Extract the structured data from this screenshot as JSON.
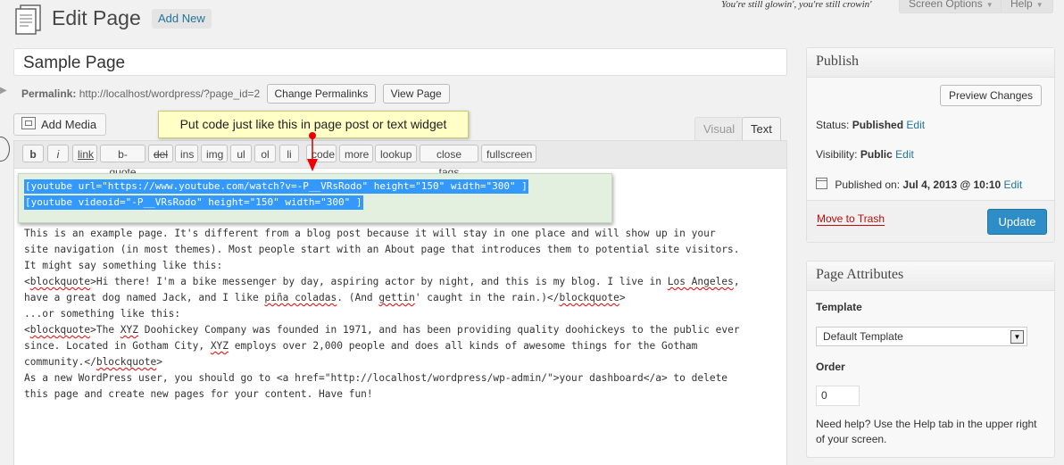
{
  "header": {
    "title": "Edit Page",
    "add_new": "Add New",
    "tagline": "You're still glowin', you're still crowin'",
    "screen_options": "Screen Options",
    "help": "Help"
  },
  "post": {
    "title": "Sample Page",
    "permalink_label": "Permalink:",
    "permalink_url": "http://localhost/wordpress/?page_id=2",
    "change_permalinks": "Change Permalinks",
    "view_page": "View Page"
  },
  "editor": {
    "add_media": "Add Media",
    "tooltip": "Put code just like this in page post or text widget",
    "tabs": {
      "visual": "Visual",
      "text": "Text"
    },
    "quicktags": [
      "b",
      "i",
      "link",
      "b-quote",
      "del",
      "ins",
      "img",
      "ul",
      "ol",
      "li",
      "code",
      "more",
      "lookup",
      "close tags",
      "fullscreen"
    ],
    "shortcode_lines": [
      "[youtube url=\"https://www.youtube.com/watch?v=-P__VRsRodo\" height=\"150\" width=\"300\" ]",
      "[youtube videoid=\"-P__VRsRodo\" height=\"150\" width=\"300\" ]"
    ],
    "content": {
      "p1": "This is an example page. It's different from a blog post because it will stay in one place and will show up in your\nsite navigation (in most themes). Most people start with an About page that introduces them to potential site visitors.\nIt might say something like this:",
      "q1_open": "<",
      "tag_blockquote": "blockquote",
      "q1_a": ">Hi there! I'm a bike messenger by day, aspiring actor by night, and this is my blog. I live in ",
      "q1_la": "Los Angeles",
      "q1_b": ",\nhave a great dog named Jack, and I like ",
      "q1_pina": "piña coladas",
      "q1_c": ". (And ",
      "q1_gettin": "gettin",
      "q1_d": "' caught in the rain.)</",
      "q1_close": ">",
      "p2": "\n...or something like this:\n",
      "q2_a": ">The ",
      "q2_xyz": "XYZ",
      "q2_b": " Doohickey Company was founded in 1971, and has been providing quality doohickeys to the public ever\nsince. Located in Gotham City, ",
      "q2_c": " employs over 2,000 people and does all kinds of awesome things for the Gotham\ncommunity.</",
      "p3": "\nAs a new WordPress user, you should go to <a href=\"http://localhost/wordpress/wp-admin/\">your dashboard</a> to delete\nthis page and create new pages for your content. Have fun!"
    }
  },
  "publish": {
    "heading": "Publish",
    "preview_changes": "Preview Changes",
    "status_label": "Status:",
    "status_value": "Published",
    "visibility_label": "Visibility:",
    "visibility_value": "Public",
    "published_on_label": "Published on:",
    "published_on_value": "Jul 4, 2013 @ 10:10",
    "edit": "Edit",
    "move_to_trash": "Move to Trash",
    "update": "Update"
  },
  "attributes": {
    "heading": "Page Attributes",
    "template_label": "Template",
    "template_value": "Default Template",
    "order_label": "Order",
    "order_value": "0",
    "help_text": "Need help? Use the Help tab in the upper right of your screen."
  },
  "colors": {
    "accent": "#21759b",
    "update_button": "#2e8cc7",
    "tooltip_bg": "#ffffc6",
    "selection": "#3399ff",
    "trash": "#bc0b0b"
  }
}
